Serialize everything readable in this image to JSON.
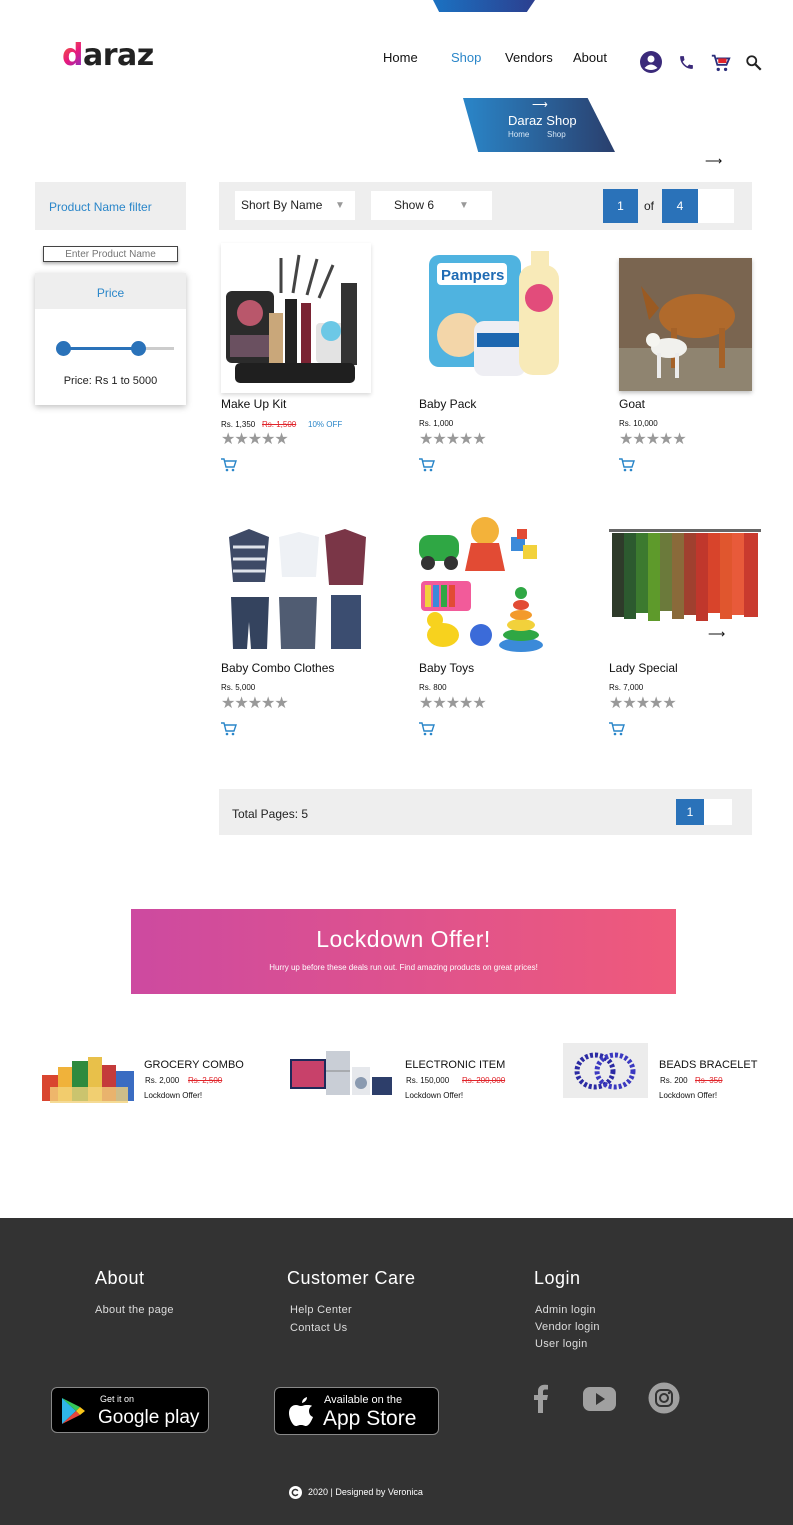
{
  "header": {
    "logo": "daraz",
    "nav": [
      "Home",
      "Shop",
      "Vendors",
      "About"
    ],
    "icons": [
      "user-icon",
      "phone-icon",
      "cart-icon",
      "search-icon"
    ]
  },
  "banner": {
    "title": "Daraz Shop",
    "crumbs": [
      "Home",
      "Shop"
    ]
  },
  "sidebar": {
    "filter_label": "Product Name filter",
    "name_input_placeholder": "Enter Product Name",
    "price_title": "Price",
    "price_text": "Price: Rs 1 to 5000",
    "slider_min_fraction": 0.0,
    "slider_max_fraction": 0.68
  },
  "toolbar": {
    "sort_label": "Short By Name",
    "show_label": "Show 6",
    "page_current": "1",
    "page_of": "of",
    "page_total": "4"
  },
  "products": [
    {
      "name": "Make Up Kit",
      "price": "Rs. 1,350",
      "old_price": "Rs. 1,500",
      "discount": "10% OFF",
      "stars": "★★★★★"
    },
    {
      "name": "Baby Pack",
      "price": "Rs. 1,000",
      "stars": "★★★★★"
    },
    {
      "name": "Goat",
      "price": "Rs. 10,000",
      "stars": "★★★★★"
    },
    {
      "name": "Baby Combo Clothes",
      "price": "Rs. 5,000",
      "stars": "★★★★★"
    },
    {
      "name": "Baby Toys",
      "price": "Rs. 800",
      "stars": "★★★★★"
    },
    {
      "name": "Lady Special",
      "price": "Rs. 7,000",
      "stars": "★★★★★"
    }
  ],
  "pager": {
    "total": "Total Pages: 5",
    "current": "1"
  },
  "offer": {
    "title": "Lockdown Offer!",
    "subtitle": "Hurry up before these deals run out. Find amazing products on great prices!"
  },
  "deals": [
    {
      "title": "GROCERY COMBO",
      "price": "Rs. 2,000",
      "old_price": "Rs. 2,500",
      "note": "Lockdown Offer!"
    },
    {
      "title": "ELECTRONIC ITEM",
      "price": "Rs. 150,000",
      "old_price": "Rs. 200,000",
      "note": "Lockdown Offer!"
    },
    {
      "title": "BEADS BRACELET",
      "price": "Rs. 200",
      "old_price": "Rs. 350",
      "note": "Lockdown Offer!"
    }
  ],
  "footer": {
    "about": {
      "title": "About",
      "links": [
        "About the page"
      ]
    },
    "care": {
      "title": "Customer Care",
      "links": [
        "Help Center",
        "Contact Us"
      ]
    },
    "login": {
      "title": "Login",
      "links": [
        "Admin login",
        "Vendor login",
        "User login"
      ]
    },
    "google_small": "Get it on",
    "google_big": "Google play",
    "apple_small": "Available on the",
    "apple_big": "App Store",
    "social": [
      "facebook-icon",
      "youtube-icon",
      "instagram-icon"
    ],
    "copyright": "2020 | Designed by Veronica"
  }
}
